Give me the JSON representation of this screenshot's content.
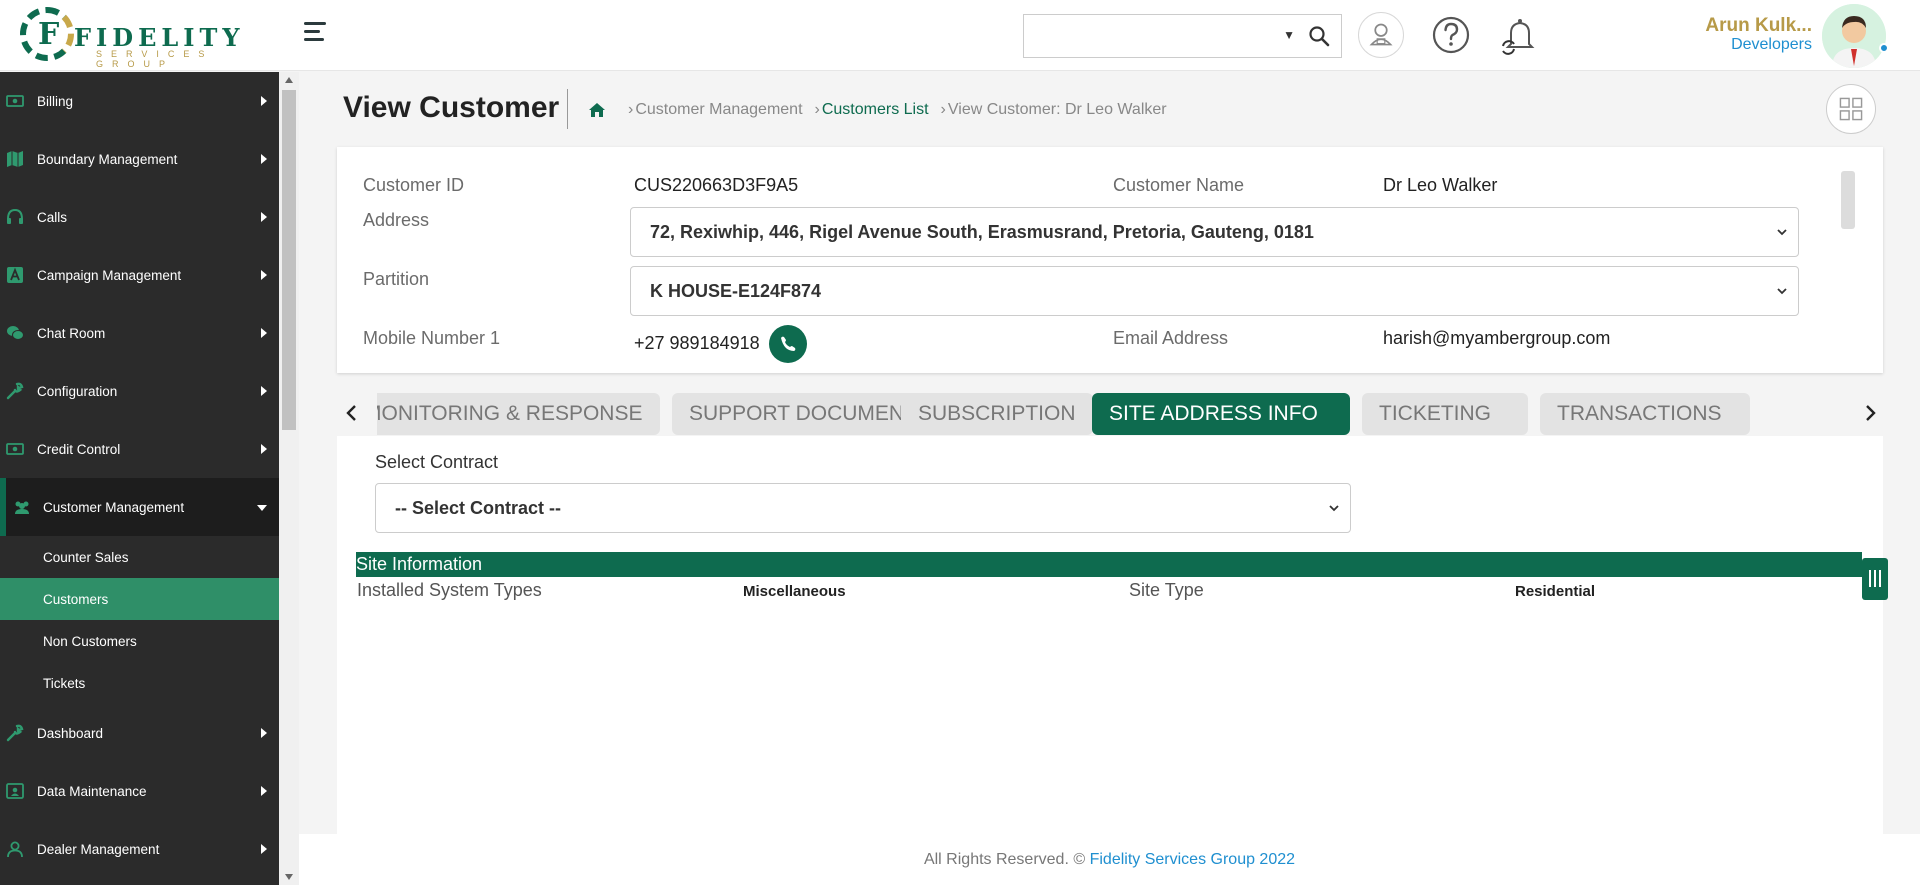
{
  "header": {
    "logo_text": "FIDELITY",
    "logo_sub": "SERVICES GROUP",
    "search_placeholder": "",
    "user_name": "Arun Kulk...",
    "user_role": "Developers"
  },
  "sidebar": {
    "items_top": [
      {
        "label": "Billing",
        "icon": "money-icon"
      },
      {
        "label": "Boundary Management",
        "icon": "map-icon"
      },
      {
        "label": "Calls",
        "icon": "headset-icon"
      },
      {
        "label": "Campaign Management",
        "icon": "campaign-icon"
      },
      {
        "label": "Chat Room",
        "icon": "chat-icon"
      },
      {
        "label": "Configuration",
        "icon": "wrench-icon"
      },
      {
        "label": "Credit Control",
        "icon": "money-icon"
      }
    ],
    "open_item": {
      "label": "Customer Management",
      "icon": "users-icon"
    },
    "sub_items": [
      {
        "label": "Counter Sales",
        "active": false
      },
      {
        "label": "Customers",
        "active": true
      },
      {
        "label": "Non Customers",
        "active": false
      },
      {
        "label": "Tickets",
        "active": false
      }
    ],
    "items_bottom": [
      {
        "label": "Dashboard",
        "icon": "wrench-icon"
      },
      {
        "label": "Data Maintenance",
        "icon": "id-card-icon"
      },
      {
        "label": "Dealer Management",
        "icon": "person-icon"
      }
    ]
  },
  "page": {
    "title": "View Customer",
    "breadcrumb": {
      "crumb1": "Customer Management",
      "crumb2": "Customers List",
      "crumb3": "View Customer: Dr Leo Walker"
    }
  },
  "customer": {
    "id_label": "Customer ID",
    "id_value": "CUS220663D3F9A5",
    "name_label": "Customer Name",
    "name_value": "Dr Leo Walker",
    "address_label": "Address",
    "address_value": "72, Rexiwhip, 446, Rigel Avenue South, Erasmusrand, Pretoria, Gauteng, 0181",
    "partition_label": "Partition",
    "partition_value": "K HOUSE-E124F874",
    "mobile_label": "Mobile Number 1",
    "mobile_value": "+27 989184918",
    "email_label": "Email Address",
    "email_value": "harish@myambergroup.com"
  },
  "tabs": [
    {
      "label": "MONITORING & RESPONSE",
      "active": false
    },
    {
      "label": "SUPPORT DOCUMENT",
      "active": false
    },
    {
      "label": "SUBSCRIPTION",
      "active": false
    },
    {
      "label": "SITE ADDRESS INFO",
      "active": true
    },
    {
      "label": "TICKETING",
      "active": false
    },
    {
      "label": "TRANSACTIONS",
      "active": false
    }
  ],
  "site_panel": {
    "contract_label": "Select Contract",
    "contract_value": "-- Select Contract --",
    "section_title": "Site Information",
    "installed_label": "Installed System Types",
    "installed_value": "Miscellaneous",
    "site_type_label": "Site Type",
    "site_type_value": "Residential"
  },
  "footer": {
    "text": "All Rights Reserved. ©",
    "brand": "Fidelity Services Group 2022"
  },
  "colors": {
    "primary": "#0e6b4f",
    "gold": "#b79a48",
    "link_blue": "#1f8fd0",
    "sidebar_bg": "#2b2b2b",
    "active_sub": "#2f8f68"
  }
}
